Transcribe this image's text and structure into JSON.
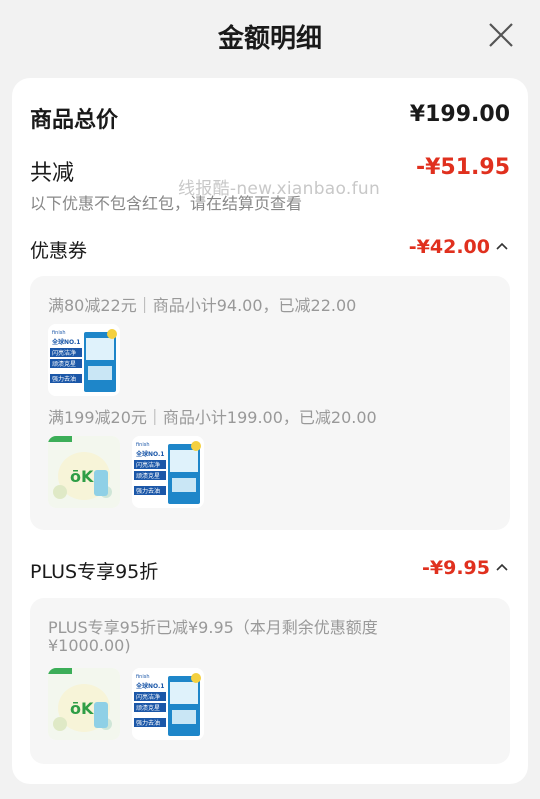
{
  "header": {
    "title": "金额明细",
    "close_icon": "close-icon"
  },
  "summary": {
    "total_label": "商品总价",
    "total_value": "¥199.00",
    "reduce_label": "共减",
    "reduce_value": "-¥51.95",
    "note": "以下优惠不包含红包，请在结算页查看"
  },
  "watermark": "线报酷-new.xianbao.fun",
  "coupon": {
    "label": "优惠券",
    "value": "-¥42.00",
    "rule1": "满80减22元｜商品小计94.00，已减22.00",
    "rule2": "满199减20元｜商品小计199.00，已减20.00"
  },
  "plus": {
    "label": "PLUS专享95折",
    "value": "-¥9.95",
    "desc_line1": "PLUS专享95折已减¥9.95（本月剩余优惠额度",
    "desc_line2": "¥1000.00)"
  },
  "product_text": {
    "brand": "finish",
    "badge": "全球NO.1",
    "slogan1": "闪亮洁净",
    "slogan2": "顽渍克星",
    "slogan3": "强力去油",
    "pod_brand": "ōKa"
  },
  "colors": {
    "accent_red": "#e0301e",
    "panel_bg": "#f6f6f6"
  }
}
